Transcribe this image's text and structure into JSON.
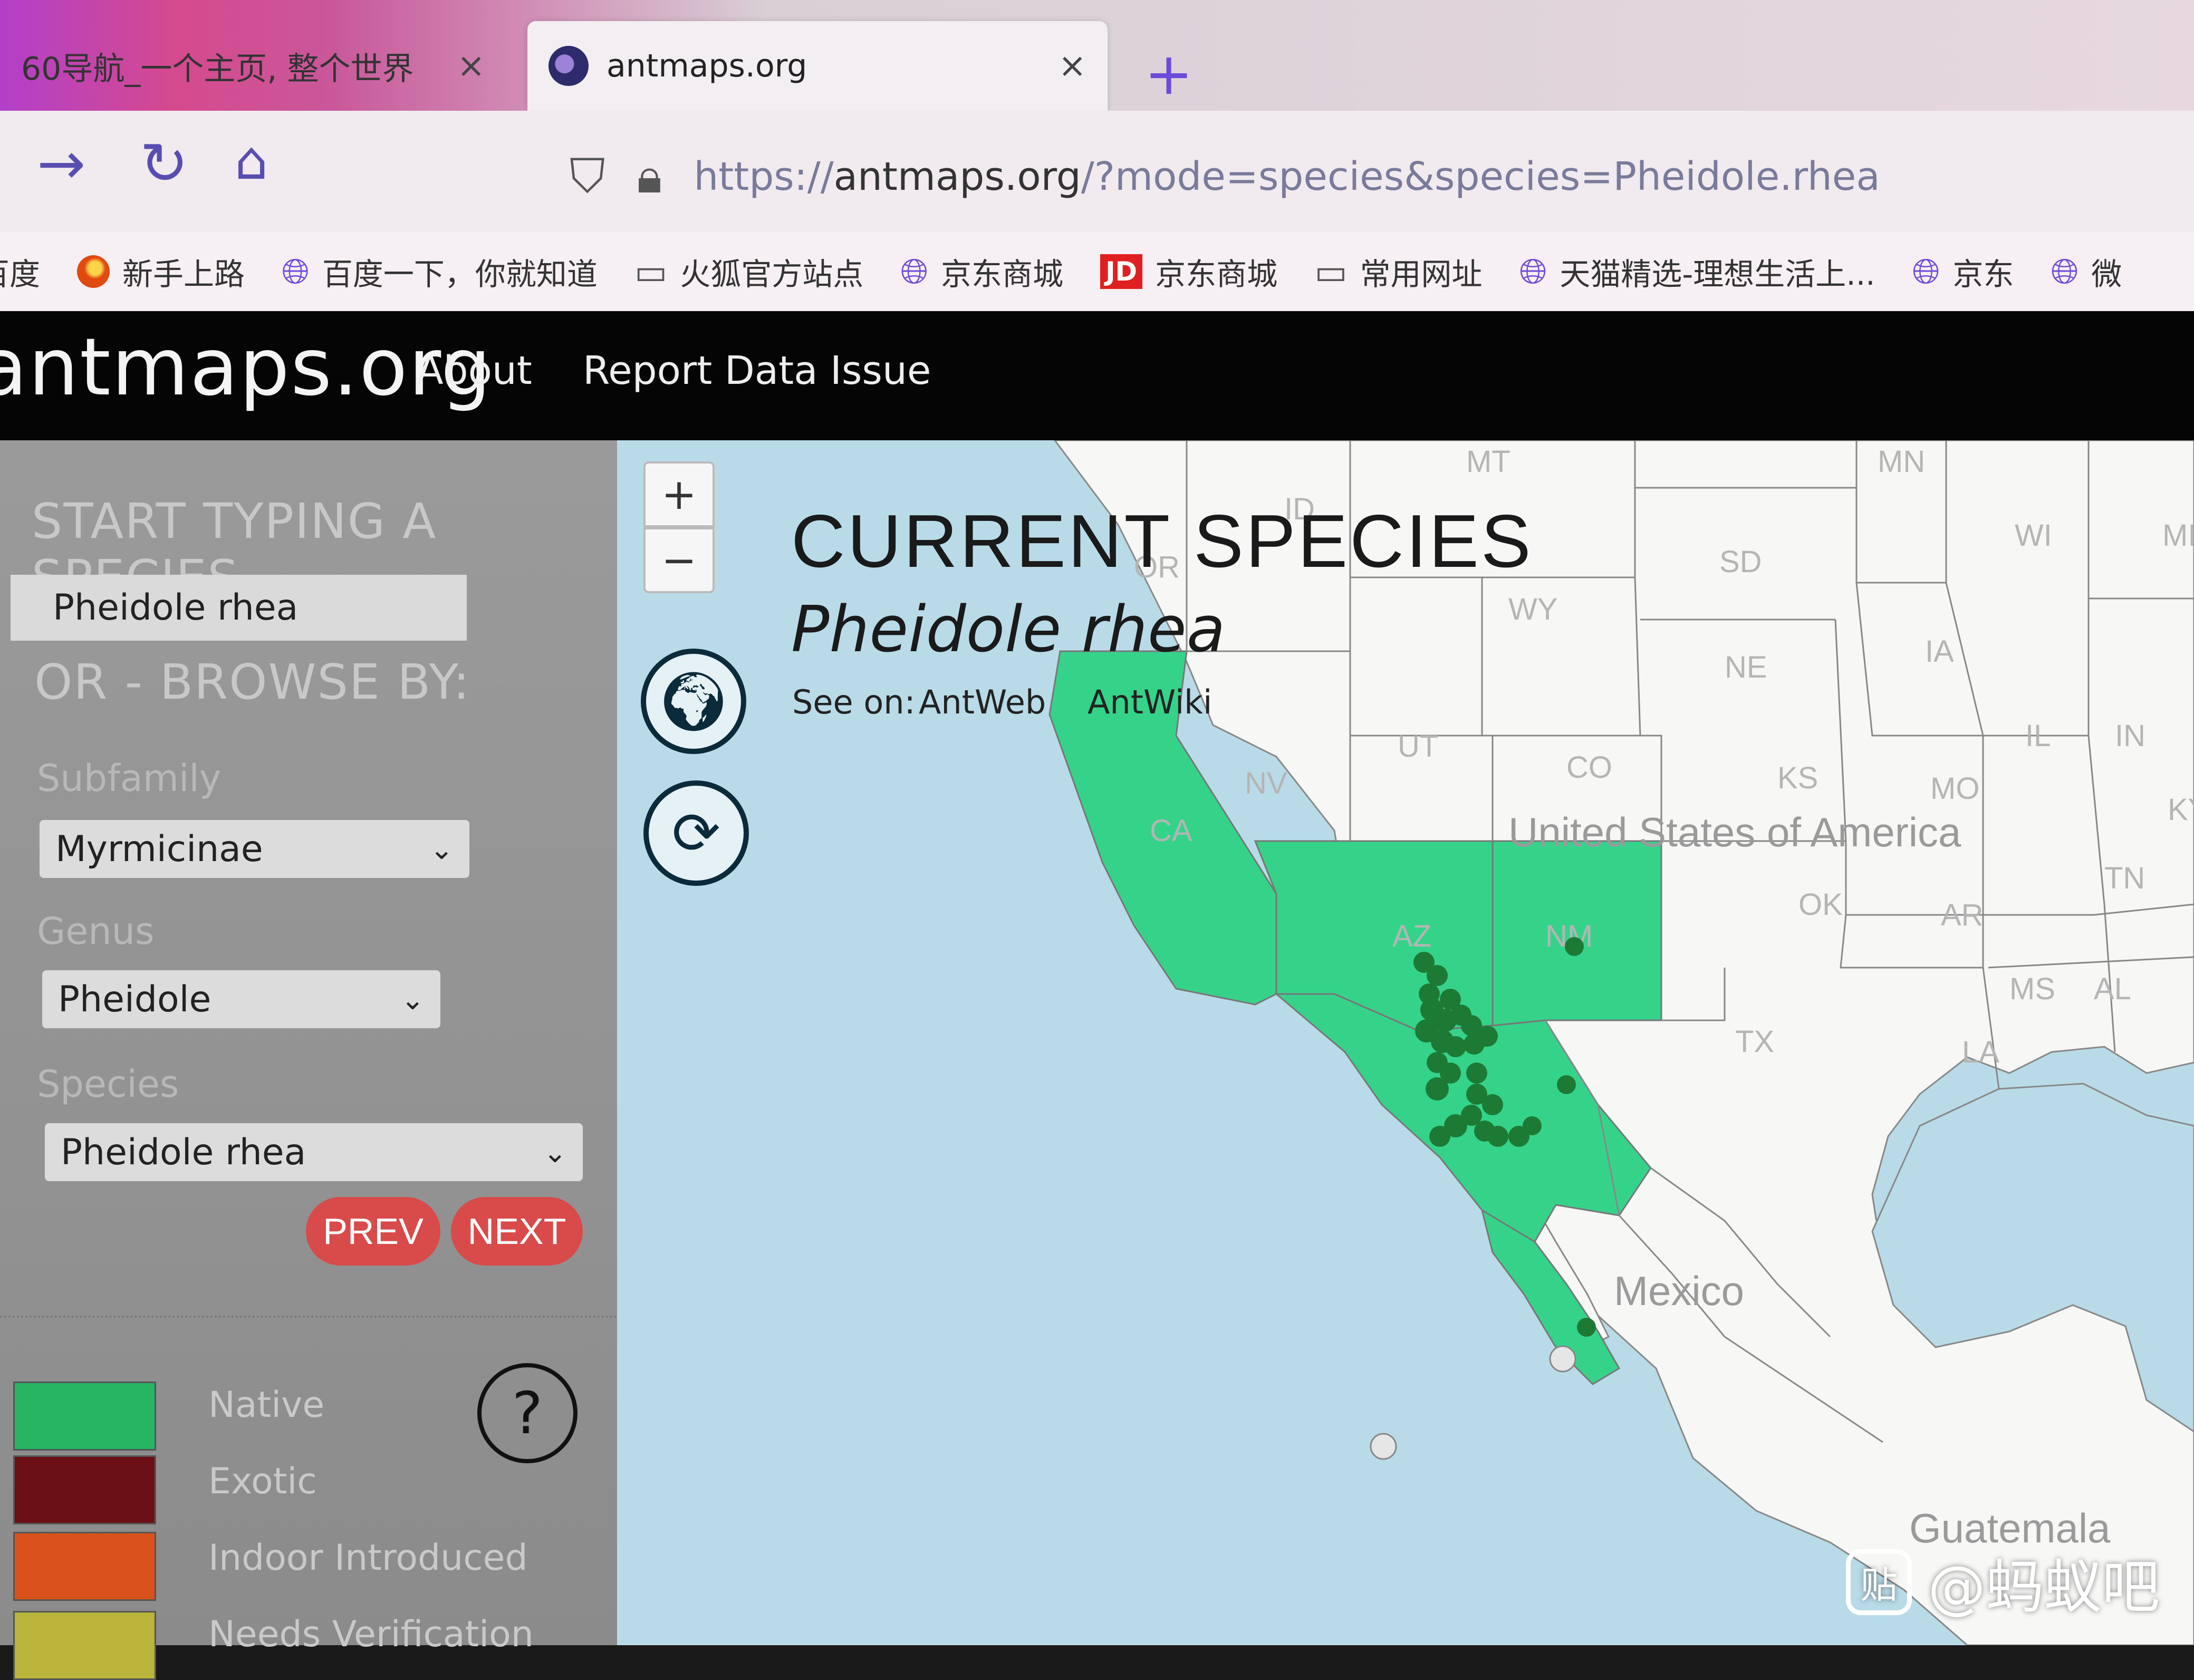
{
  "browser": {
    "tabs": [
      {
        "label": "60导航_一个主页, 整个世界",
        "close": "×"
      },
      {
        "label": "antmaps.org",
        "close": "×"
      }
    ],
    "new_tab": "+",
    "url": {
      "scheme": "https://",
      "host": "antmaps.org",
      "path": "/?mode=species&species=Pheidole.rhea"
    },
    "bookmarks": [
      {
        "label": "百度",
        "icon": "none"
      },
      {
        "label": "新手上路",
        "icon": "firefox-icon"
      },
      {
        "label": "百度一下，你就知道",
        "icon": "globe-icon"
      },
      {
        "label": "火狐官方站点",
        "icon": "folder-icon"
      },
      {
        "label": "京东商城",
        "icon": "globe-icon"
      },
      {
        "label": "京东商城",
        "icon": "jd-icon",
        "badge": "JD"
      },
      {
        "label": "常用网址",
        "icon": "folder-icon"
      },
      {
        "label": "天猫精选-理想生活上...",
        "icon": "globe-icon"
      },
      {
        "label": "京东",
        "icon": "globe-icon"
      },
      {
        "label": "微",
        "icon": "globe-icon"
      }
    ]
  },
  "site": {
    "logo": "antmaps.org",
    "nav": {
      "about": "About",
      "report": "Report Data Issue"
    }
  },
  "sidebar": {
    "start_heading": "START TYPING A SPECIES",
    "search_value": "Pheidole rhea",
    "browse_heading": "OR - BROWSE BY:",
    "subfamily": {
      "label": "Subfamily",
      "value": "Myrmicinae"
    },
    "genus": {
      "label": "Genus",
      "value": "Pheidole"
    },
    "species": {
      "label": "Species",
      "value": "Pheidole rhea"
    },
    "prev": "PREV",
    "next": "NEXT",
    "help": "?",
    "legend": [
      {
        "label": "Native",
        "color": "#27b564"
      },
      {
        "label": "Exotic",
        "color": "#6b1015"
      },
      {
        "label": "Indoor Introduced",
        "color": "#d9521c"
      },
      {
        "label": "Needs Verification",
        "color": "#b9b43a"
      }
    ]
  },
  "map": {
    "zoom_in": "+",
    "zoom_out": "−",
    "current_title": "CURRENT SPECIES",
    "current_species": "Pheidole rhea",
    "see_on": "See on:",
    "links": {
      "antweb": "AntWeb",
      "antwiki": "AntWiki"
    },
    "native_color": "#35d38a",
    "record_color": "#1d7a35",
    "state_labels": [
      "MT",
      "ID",
      "OR",
      "WY",
      "SD",
      "MN",
      "WI",
      "MI",
      "NE",
      "IA",
      "IL",
      "IN",
      "KY",
      "UT",
      "CO",
      "KS",
      "MO",
      "NV",
      "CA",
      "TN",
      "OK",
      "AR",
      "AZ",
      "NM",
      "MS",
      "AL",
      "TX",
      "LA"
    ],
    "country_labels": {
      "usa": "United States of America",
      "mexico": "Mexico",
      "guatemala": "Guatemala"
    }
  },
  "watermark": {
    "logo": "贴",
    "text": "@蚂蚁吧"
  }
}
